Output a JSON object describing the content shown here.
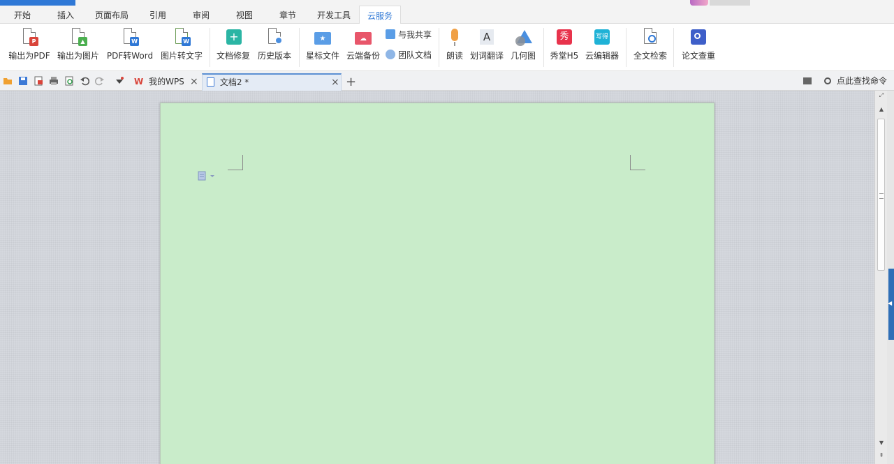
{
  "menu": {
    "tabs": [
      {
        "label": "开始"
      },
      {
        "label": "插入"
      },
      {
        "label": "页面布局"
      },
      {
        "label": "引用"
      },
      {
        "label": "审阅"
      },
      {
        "label": "视图"
      },
      {
        "label": "章节"
      },
      {
        "label": "开发工具"
      },
      {
        "label": "云服务",
        "active": true
      }
    ]
  },
  "ribbon": {
    "buttons": [
      {
        "label": "输出为PDF",
        "icon": "export-pdf-icon"
      },
      {
        "label": "输出为图片",
        "icon": "export-image-icon"
      },
      {
        "label": "PDF转Word",
        "icon": "pdf-to-word-icon"
      },
      {
        "label": "图片转文字",
        "icon": "image-to-text-icon"
      },
      {
        "label": "文档修复",
        "icon": "doc-repair-icon"
      },
      {
        "label": "历史版本",
        "icon": "history-version-icon"
      },
      {
        "label": "星标文件",
        "icon": "starred-file-icon"
      },
      {
        "label": "云端备份",
        "icon": "cloud-backup-icon"
      },
      {
        "label": "朗读",
        "icon": "read-aloud-icon"
      },
      {
        "label": "划词翻译",
        "icon": "translate-icon"
      },
      {
        "label": "几何图",
        "icon": "geometry-icon"
      },
      {
        "label": "秀堂H5",
        "icon": "xiutang-h5-icon"
      },
      {
        "label": "云编辑器",
        "icon": "cloud-editor-icon"
      },
      {
        "label": "全文检索",
        "icon": "fulltext-search-icon"
      },
      {
        "label": "论文查重",
        "icon": "paper-check-icon"
      }
    ],
    "small": {
      "share_with_me": "与我共享",
      "team_docs": "团队文档"
    },
    "icon_text": {
      "xiu": "秀",
      "xiede": "写得",
      "a": "A"
    }
  },
  "quickbar": {
    "tabs": [
      {
        "label": "我的WPS"
      },
      {
        "label": "文档2 *",
        "active": true
      }
    ],
    "add": "+",
    "close": "×",
    "find_command": "点此查找命令"
  },
  "colors": {
    "accent": "#2f78d6",
    "page_bg": "#c9ecca"
  }
}
